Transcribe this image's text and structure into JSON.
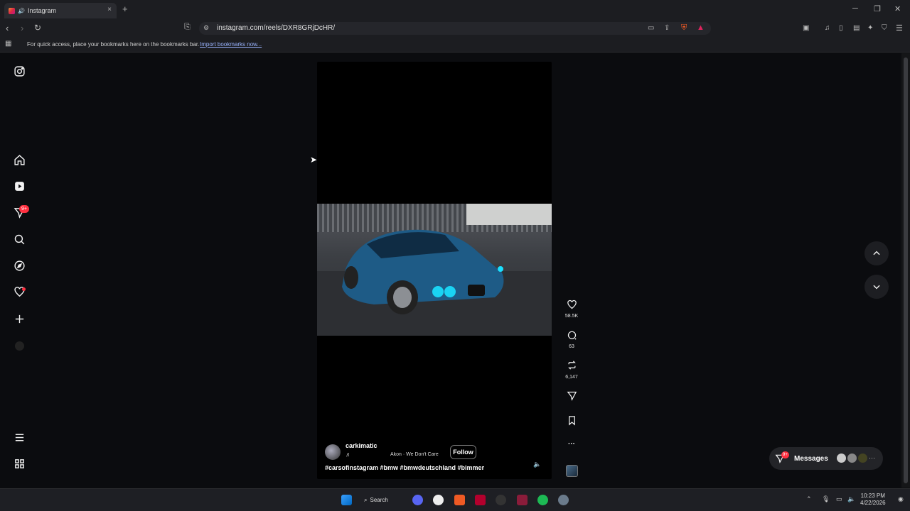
{
  "browser": {
    "tab_title": "Instagram",
    "tab_close": "×",
    "new_tab": "+",
    "url": "instagram.com/reels/DXR8GRjDcHR/",
    "bookmarks_hint": "For quick access, place your bookmarks here on the bookmarks bar.",
    "import_link": "Import bookmarks now..."
  },
  "sidebar": {
    "notifications_badge": "9+"
  },
  "reel": {
    "creator": "carkimatic",
    "music_note": "♬",
    "song": "Akon · We Don't Care",
    "follow_label": "Follow",
    "caption": "#carsofinstagram #bmw #bmwdeutschland #bimmer",
    "likes": "58.5K",
    "comments": "63",
    "reposts": "6,147",
    "more": "···"
  },
  "messages": {
    "label": "Messages",
    "badge": "9+",
    "more": "···"
  },
  "taskbar": {
    "search_label": "Search",
    "time": "10:23 PM",
    "date": "4/22/2026"
  },
  "colors": {
    "badge": "#ff3040",
    "background": "#0b0c0f",
    "accent_link": "#9ab4ff"
  }
}
